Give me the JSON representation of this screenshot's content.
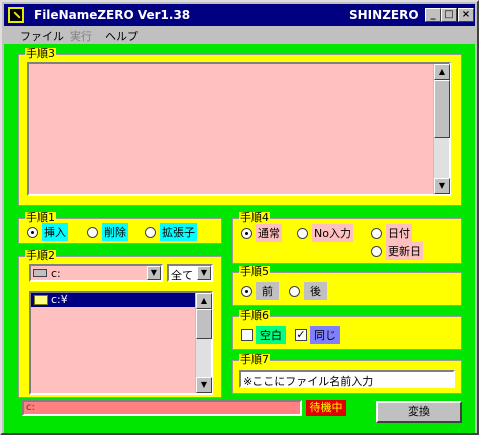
{
  "window": {
    "title": "FileNameZERO Ver1.38",
    "brand": "SHINZERO"
  },
  "titlebar_buttons": [
    "_",
    "□",
    "×"
  ],
  "menu": {
    "file": "ファイル",
    "run": "実行",
    "help": "ヘルプ"
  },
  "step3": {
    "legend": "手順3",
    "text": ""
  },
  "step1": {
    "legend": "手順1",
    "options": [
      "挿入",
      "削除",
      "拡張子"
    ],
    "selected": "挿入"
  },
  "step2": {
    "legend": "手順2",
    "drive": "c:",
    "filter": "全て",
    "folder": "c:¥"
  },
  "step4": {
    "legend": "手順4",
    "options": [
      "通常",
      "No入力",
      "日付",
      "更新日"
    ],
    "selected": "通常"
  },
  "step5": {
    "legend": "手順5",
    "options": [
      "前",
      "後"
    ],
    "selected": "前"
  },
  "step6": {
    "legend": "手順6",
    "options": [
      "空白",
      "同じ"
    ],
    "checked": [
      "同じ"
    ]
  },
  "step7": {
    "legend": "手順7",
    "placeholder": "※ここにファイル名前入力"
  },
  "status": {
    "path": "c:",
    "state": "待機中"
  },
  "convert_button": "変換",
  "colors": {
    "client_bg": "#00e600",
    "group_bg": "#ffff00",
    "pink": "#ffc0c0",
    "cyan": "#00ffff",
    "status_red": "#e00000",
    "title_blue": "#000080",
    "violet": "#8080ff"
  }
}
